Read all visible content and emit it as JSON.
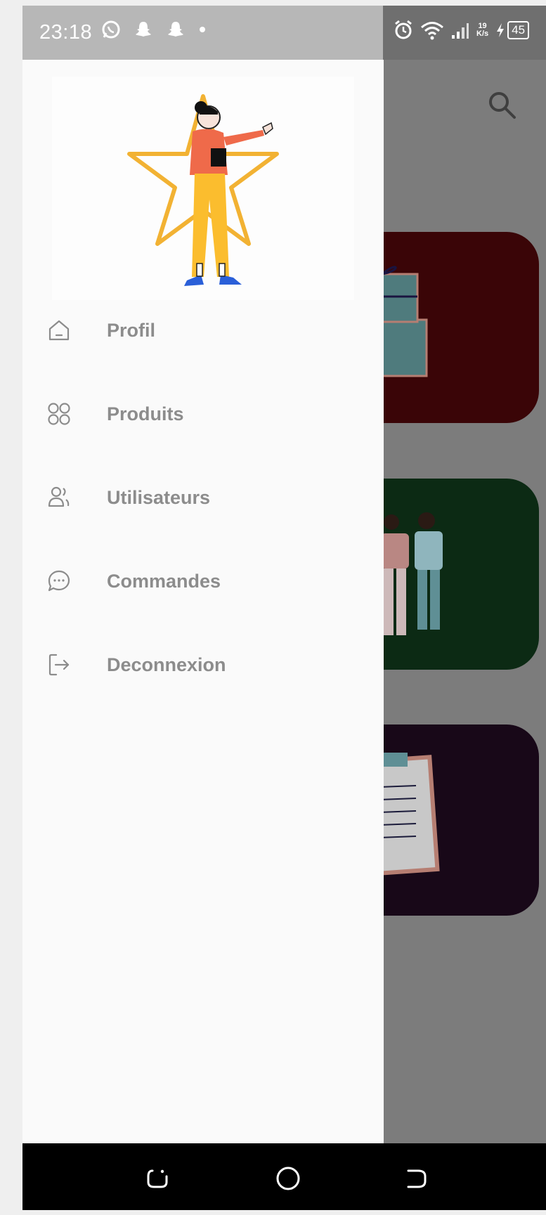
{
  "status_bar": {
    "time": "23:18",
    "net_speed_value": "19",
    "net_speed_unit": "K/s",
    "battery": "45",
    "left_icons": [
      "whatsapp-icon",
      "snapchat-icon",
      "snapchat-icon",
      "dot-icon"
    ],
    "right_icons": [
      "alarm-icon",
      "wifi-icon",
      "signal-icon",
      "charging-icon"
    ]
  },
  "drawer": {
    "menu": [
      {
        "label": "Profil",
        "icon": "home-icon"
      },
      {
        "label": "Produits",
        "icon": "grid-icon"
      },
      {
        "label": "Utilisateurs",
        "icon": "users-icon"
      },
      {
        "label": "Commandes",
        "icon": "chat-icon"
      },
      {
        "label": "Deconnexion",
        "icon": "logout-icon"
      }
    ]
  },
  "background": {
    "toolbar_icon": "search-icon",
    "cards": [
      {
        "illustration": "gift-boxes",
        "color": "#3a0507"
      },
      {
        "illustration": "people-group",
        "color": "#0c2a14"
      },
      {
        "illustration": "clipboard-checklist",
        "color": "#180818"
      }
    ]
  },
  "navigation_bar": {
    "buttons": [
      "recent-apps-icon",
      "home-button-icon",
      "back-icon"
    ]
  }
}
